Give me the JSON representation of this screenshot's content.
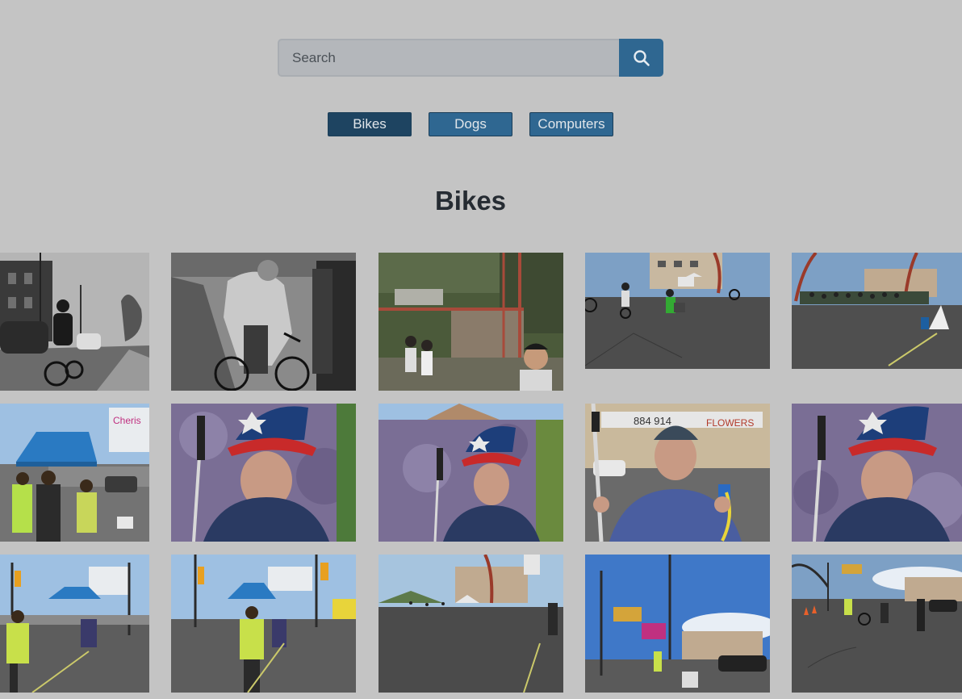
{
  "search": {
    "placeholder": "Search",
    "button_icon": "search-icon"
  },
  "filters": [
    {
      "label": "Bikes",
      "active": true
    },
    {
      "label": "Dogs",
      "active": false
    },
    {
      "label": "Computers",
      "active": false
    }
  ],
  "section": {
    "title": "Bikes"
  },
  "colors": {
    "background": "#c4c4c4",
    "accent": "#2f6791",
    "accent_active": "#1e4461",
    "title": "#262c33"
  },
  "photos": [
    {
      "subject": "black-and-white street with cyclist"
    },
    {
      "subject": "black-and-white cyclist in hoodie"
    },
    {
      "subject": "children on balcony"
    },
    {
      "subject": "street with cyclists"
    },
    {
      "subject": "crowd of cyclists at intersection"
    },
    {
      "subject": "blue tent and volunteers"
    },
    {
      "subject": "man in patriotic hat"
    },
    {
      "subject": "man in patriotic hat with purple backdrop"
    },
    {
      "subject": "man holding rope"
    },
    {
      "subject": "man in patriotic hat close-up"
    },
    {
      "subject": "volunteer measuring street"
    },
    {
      "subject": "volunteers with tape on street"
    },
    {
      "subject": "empty street with arch"
    },
    {
      "subject": "intersection with billboards"
    },
    {
      "subject": "street with cones and cyclists"
    }
  ]
}
